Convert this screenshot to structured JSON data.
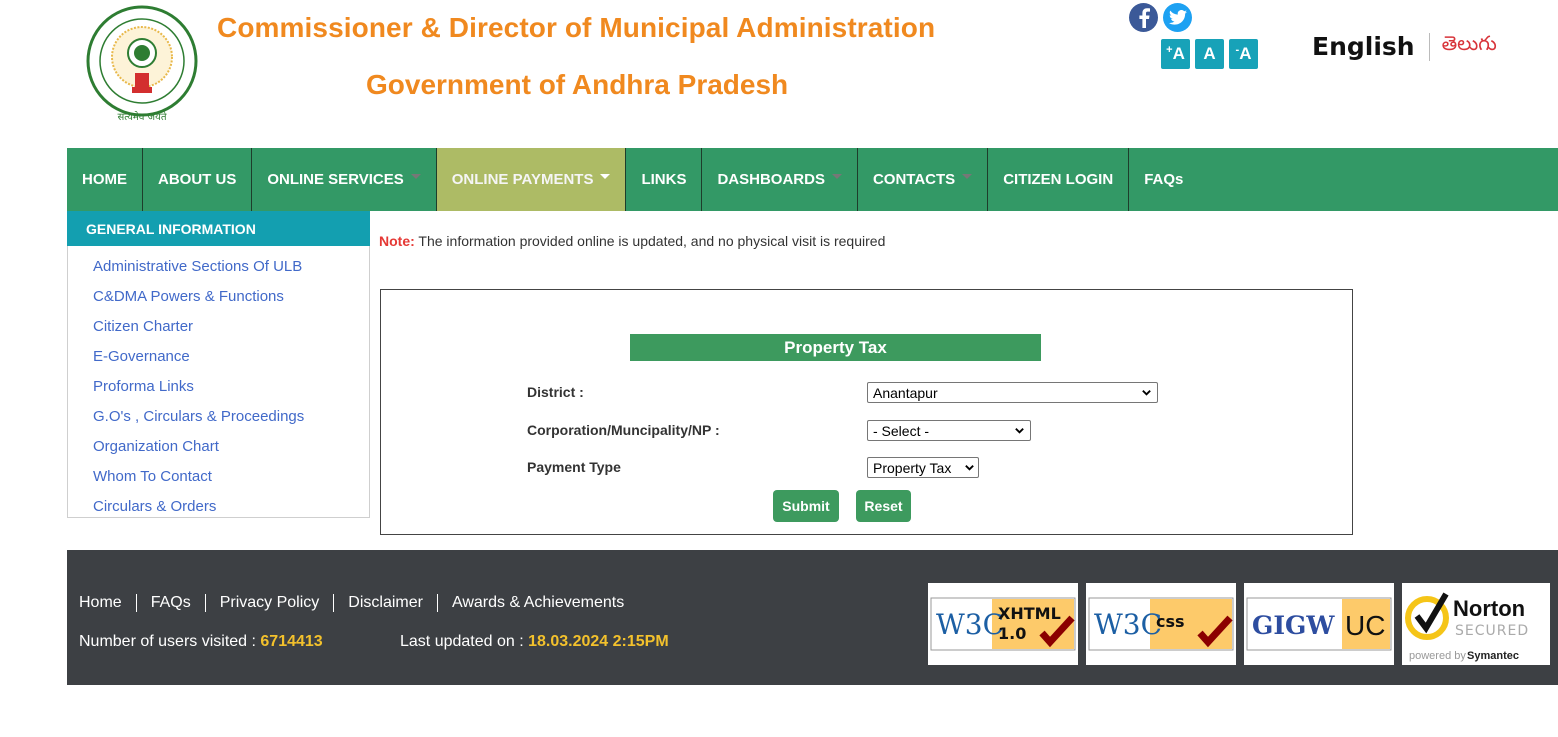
{
  "header": {
    "title_line1": "Commissioner & Director of Municipal Administration",
    "title_line2": "Government of Andhra Pradesh",
    "emblem_alt": "Government of Andhra Pradesh emblem",
    "social": [
      {
        "name": "facebook-icon",
        "label": "f"
      },
      {
        "name": "twitter-icon",
        "label": "twitter"
      }
    ],
    "font_size_buttons": [
      {
        "prefix": "+",
        "label": "A"
      },
      {
        "prefix": "",
        "label": "A"
      },
      {
        "prefix": "-",
        "label": "A"
      }
    ],
    "languages": {
      "english": "English",
      "telugu": "తెలుగు"
    }
  },
  "nav": {
    "items": [
      {
        "label": "HOME",
        "has_dropdown": false,
        "active": false
      },
      {
        "label": "ABOUT US",
        "has_dropdown": false,
        "active": false
      },
      {
        "label": "ONLINE SERVICES",
        "has_dropdown": true,
        "active": false
      },
      {
        "label": "ONLINE PAYMENTS",
        "has_dropdown": true,
        "active": true
      },
      {
        "label": "LINKS",
        "has_dropdown": false,
        "active": false
      },
      {
        "label": "DASHBOARDS",
        "has_dropdown": true,
        "active": false
      },
      {
        "label": "CONTACTS",
        "has_dropdown": true,
        "active": false
      },
      {
        "label": "CITIZEN LOGIN",
        "has_dropdown": false,
        "active": false
      },
      {
        "label": "FAQs",
        "has_dropdown": false,
        "active": false
      }
    ]
  },
  "sidebar": {
    "heading": "GENERAL INFORMATION",
    "items": [
      {
        "label": "Administrative Sections Of ULB"
      },
      {
        "label": "C&DMA Powers & Functions"
      },
      {
        "label": "Citizen Charter"
      },
      {
        "label": "E-Governance"
      },
      {
        "label": "Proforma Links"
      },
      {
        "label": "G.O's , Circulars & Proceedings"
      },
      {
        "label": "Organization Chart"
      },
      {
        "label": "Whom To Contact"
      },
      {
        "label": "Circulars & Orders"
      }
    ]
  },
  "note": {
    "label": "Note:",
    "text": " The information provided online is updated, and no physical visit is required"
  },
  "form": {
    "title": "Property Tax",
    "district_label": "District :",
    "district_value": "Anantapur",
    "ulb_label": "Corporation/Muncipality/NP :",
    "ulb_value": "- Select -",
    "payment_type_label": "Payment Type",
    "payment_type_value": "Property Tax",
    "submit_label": "Submit",
    "reset_label": "Reset"
  },
  "footer": {
    "links": [
      {
        "label": "Home"
      },
      {
        "label": "FAQs"
      },
      {
        "label": "Privacy Policy"
      },
      {
        "label": "Disclaimer"
      },
      {
        "label": "Awards & Achievements"
      }
    ],
    "visitors_label": "Number of users visited : ",
    "visitors_value": "6714413",
    "updated_label": "Last updated on : ",
    "updated_value": "18.03.2024 2:15PM",
    "badges": [
      {
        "name": "w3c-xhtml-badge",
        "logo": "W3C",
        "text1": "XHTML",
        "text2": "1.0"
      },
      {
        "name": "w3c-css-badge",
        "logo": "W3C",
        "text1": "css",
        "text2": ""
      },
      {
        "name": "gigw-badge",
        "text1": "GIGW",
        "text2": "UC"
      },
      {
        "name": "norton-badge",
        "text1": "Norton",
        "text2": "SECURED",
        "text3": "powered by",
        "text4": "Symantec"
      }
    ]
  },
  "colors": {
    "title_orange": "#f0891f",
    "nav_green": "#339966",
    "nav_active": "#adbb65",
    "sidebar_head": "#139fb0",
    "link_blue": "#4169c9",
    "button_green": "#3d9a5e",
    "footer_bg": "#3d4044",
    "footer_highlight": "#f3c12c",
    "note_red": "#e53935"
  }
}
